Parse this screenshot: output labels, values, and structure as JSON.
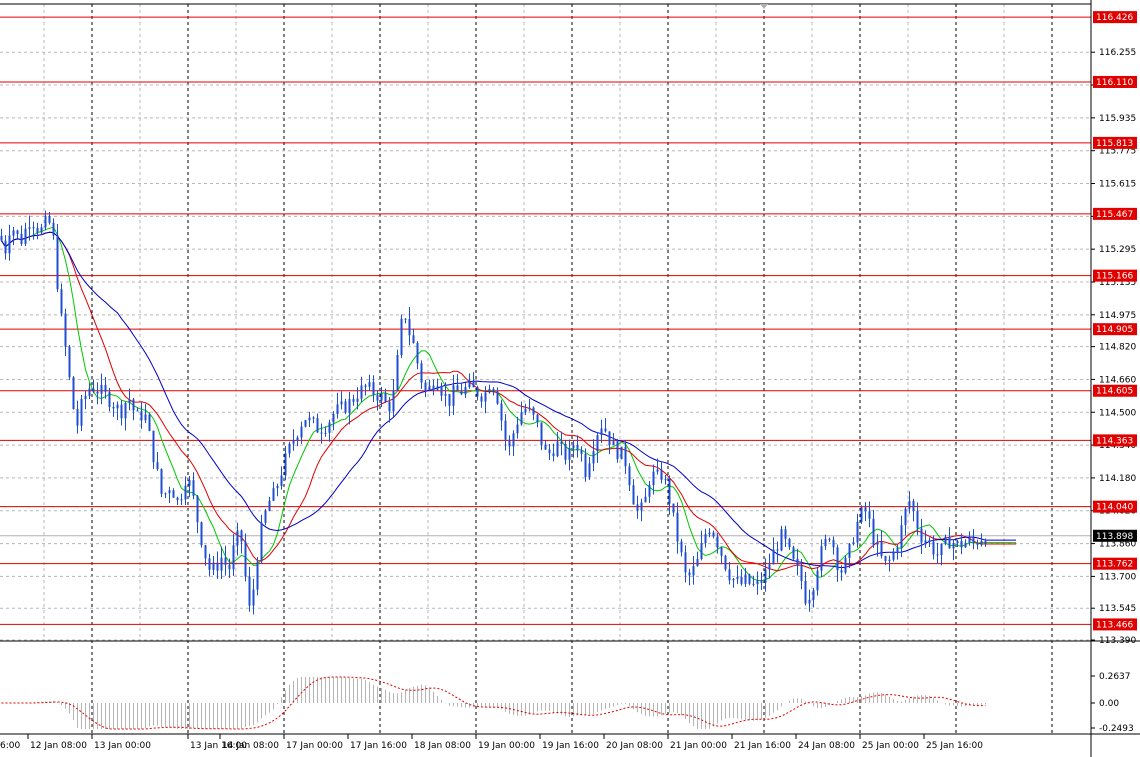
{
  "chart_data": {
    "type": "candlestick",
    "price_axis": {
      "range": [
        113.39,
        116.49
      ],
      "ticks": [
        "116.255",
        "116.095",
        "115.935",
        "115.775",
        "115.615",
        "115.455",
        "115.295",
        "115.135",
        "114.975",
        "114.820",
        "114.660",
        "114.500",
        "114.340",
        "114.180",
        "114.020",
        "113.860",
        "113.700",
        "113.545",
        "113.390"
      ]
    },
    "levels": [
      {
        "value": 116.426,
        "label": "116.426"
      },
      {
        "value": 116.11,
        "label": "116.110"
      },
      {
        "value": 115.813,
        "label": "115.813"
      },
      {
        "value": 115.467,
        "label": "115.467"
      },
      {
        "value": 115.166,
        "label": "115.166"
      },
      {
        "value": 114.905,
        "label": "114.905"
      },
      {
        "value": 114.605,
        "label": "114.605"
      },
      {
        "value": 114.363,
        "label": "114.363"
      },
      {
        "value": 114.04,
        "label": "114.040"
      },
      {
        "value": 113.762,
        "label": "113.762"
      },
      {
        "value": 113.466,
        "label": "113.466"
      }
    ],
    "current_price": {
      "value": 113.898,
      "label": "113.898"
    },
    "time_axis": {
      "labels": [
        "12 Jan 08:00",
        "13 Jan 00:00",
        "13 Jan 16:00",
        "14 Jan 08:00",
        "17 Jan 00:00",
        "17 Jan 16:00",
        "18 Jan 08:00",
        "19 Jan 00:00",
        "19 Jan 16:00",
        "20 Jan 08:00",
        "21 Jan 00:00",
        "21 Jan 16:00",
        "24 Jan 08:00",
        "25 Jan 00:00",
        "25 Jan 16:00"
      ],
      "partial_left_label": "6:00"
    },
    "price_path": [
      [
        0,
        115.36
      ],
      [
        4,
        115.27
      ],
      [
        10,
        115.42
      ],
      [
        20,
        115.33
      ],
      [
        30,
        115.45
      ],
      [
        40,
        115.38
      ],
      [
        48,
        115.44
      ],
      [
        55,
        115.3
      ],
      [
        58,
        115.05
      ],
      [
        64,
        114.85
      ],
      [
        70,
        114.62
      ],
      [
        76,
        114.42
      ],
      [
        82,
        114.55
      ],
      [
        90,
        114.63
      ],
      [
        100,
        114.6
      ],
      [
        110,
        114.56
      ],
      [
        120,
        114.5
      ],
      [
        128,
        114.58
      ],
      [
        136,
        114.47
      ],
      [
        144,
        114.5
      ],
      [
        150,
        114.36
      ],
      [
        156,
        114.22
      ],
      [
        162,
        114.08
      ],
      [
        170,
        114.15
      ],
      [
        178,
        114.05
      ],
      [
        186,
        114.2
      ],
      [
        192,
        114.1
      ],
      [
        198,
        113.95
      ],
      [
        204,
        113.82
      ],
      [
        210,
        113.72
      ],
      [
        216,
        113.75
      ],
      [
        222,
        113.8
      ],
      [
        228,
        113.72
      ],
      [
        234,
        113.85
      ],
      [
        240,
        113.92
      ],
      [
        246,
        113.65
      ],
      [
        250,
        113.5
      ],
      [
        256,
        113.78
      ],
      [
        262,
        113.95
      ],
      [
        268,
        114.06
      ],
      [
        274,
        114.1
      ],
      [
        280,
        114.2
      ],
      [
        286,
        114.28
      ],
      [
        292,
        114.36
      ],
      [
        298,
        114.42
      ],
      [
        304,
        114.48
      ],
      [
        310,
        114.45
      ],
      [
        318,
        114.42
      ],
      [
        326,
        114.44
      ],
      [
        334,
        114.5
      ],
      [
        342,
        114.52
      ],
      [
        350,
        114.55
      ],
      [
        358,
        114.6
      ],
      [
        366,
        114.62
      ],
      [
        372,
        114.6
      ],
      [
        380,
        114.58
      ],
      [
        388,
        114.52
      ],
      [
        394,
        114.6
      ],
      [
        400,
        114.9
      ],
      [
        404,
        115.0
      ],
      [
        408,
        114.9
      ],
      [
        412,
        114.85
      ],
      [
        418,
        114.72
      ],
      [
        424,
        114.6
      ],
      [
        430,
        114.62
      ],
      [
        436,
        114.68
      ],
      [
        442,
        114.6
      ],
      [
        448,
        114.55
      ],
      [
        454,
        114.6
      ],
      [
        460,
        114.6
      ],
      [
        468,
        114.62
      ],
      [
        476,
        114.6
      ],
      [
        484,
        114.58
      ],
      [
        490,
        114.66
      ],
      [
        496,
        114.6
      ],
      [
        502,
        114.44
      ],
      [
        508,
        114.3
      ],
      [
        514,
        114.42
      ],
      [
        520,
        114.5
      ],
      [
        526,
        114.52
      ],
      [
        532,
        114.48
      ],
      [
        538,
        114.42
      ],
      [
        544,
        114.3
      ],
      [
        550,
        114.3
      ],
      [
        556,
        114.35
      ],
      [
        562,
        114.3
      ],
      [
        568,
        114.28
      ],
      [
        574,
        114.36
      ],
      [
        580,
        114.32
      ],
      [
        584,
        114.2
      ],
      [
        590,
        114.3
      ],
      [
        596,
        114.4
      ],
      [
        602,
        114.45
      ],
      [
        608,
        114.38
      ],
      [
        614,
        114.32
      ],
      [
        620,
        114.3
      ],
      [
        626,
        114.25
      ],
      [
        632,
        114.1
      ],
      [
        638,
        114.0
      ],
      [
        644,
        114.05
      ],
      [
        650,
        114.2
      ],
      [
        656,
        114.18
      ],
      [
        662,
        114.2
      ],
      [
        668,
        114.1
      ],
      [
        674,
        113.95
      ],
      [
        680,
        113.82
      ],
      [
        686,
        113.68
      ],
      [
        692,
        113.72
      ],
      [
        698,
        113.78
      ],
      [
        704,
        113.9
      ],
      [
        710,
        113.95
      ],
      [
        716,
        113.88
      ],
      [
        722,
        113.8
      ],
      [
        728,
        113.72
      ],
      [
        734,
        113.68
      ],
      [
        740,
        113.66
      ],
      [
        746,
        113.68
      ],
      [
        752,
        113.65
      ],
      [
        758,
        113.66
      ],
      [
        764,
        113.7
      ],
      [
        770,
        113.78
      ],
      [
        776,
        113.85
      ],
      [
        782,
        113.9
      ],
      [
        788,
        113.82
      ],
      [
        794,
        113.75
      ],
      [
        800,
        113.7
      ],
      [
        806,
        113.58
      ],
      [
        812,
        113.65
      ],
      [
        818,
        113.78
      ],
      [
        824,
        113.85
      ],
      [
        830,
        113.92
      ],
      [
        836,
        113.78
      ],
      [
        842,
        113.72
      ],
      [
        848,
        113.8
      ],
      [
        854,
        113.92
      ],
      [
        860,
        114.0
      ],
      [
        866,
        114.02
      ],
      [
        872,
        113.9
      ],
      [
        878,
        113.82
      ],
      [
        884,
        113.75
      ],
      [
        890,
        113.78
      ],
      [
        896,
        113.85
      ],
      [
        902,
        113.95
      ],
      [
        908,
        114.08
      ],
      [
        914,
        114.0
      ],
      [
        920,
        113.9
      ],
      [
        926,
        113.88
      ],
      [
        932,
        113.84
      ],
      [
        938,
        113.8
      ],
      [
        944,
        113.85
      ],
      [
        950,
        113.88
      ],
      [
        956,
        113.85
      ],
      [
        962,
        113.86
      ],
      [
        968,
        113.87
      ],
      [
        974,
        113.86
      ],
      [
        980,
        113.89
      ],
      [
        986,
        113.9
      ]
    ],
    "oscillator": {
      "ticks": [
        "0.2637",
        "0.00",
        "-0.2493"
      ]
    }
  }
}
